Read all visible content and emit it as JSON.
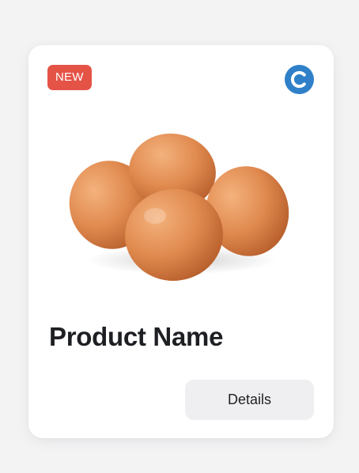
{
  "card": {
    "badge": "NEW",
    "brand_icon": "c-logo-icon",
    "image_icon": "eggs-image",
    "title": "Product Name",
    "button_label": "Details"
  },
  "colors": {
    "background": "#f3f3f4",
    "card": "#ffffff",
    "badge": "#e55347",
    "brand": "#2f80c9",
    "button": "#efeff1",
    "title": "#1d1f23"
  }
}
